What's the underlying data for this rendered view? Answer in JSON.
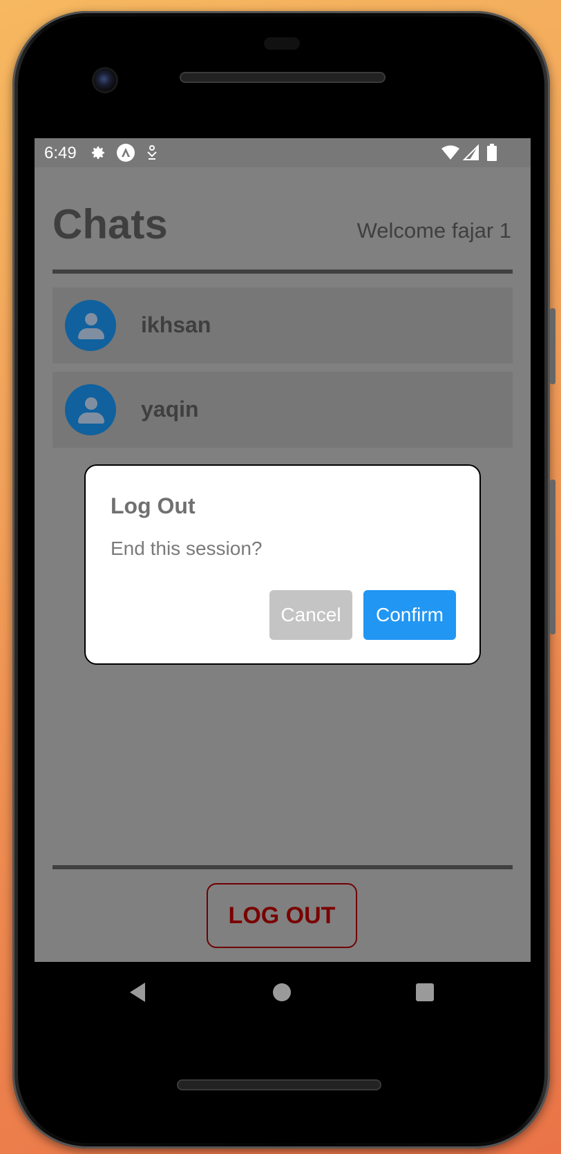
{
  "status_bar": {
    "time": "6:49",
    "icons_left": [
      "gear-icon",
      "app-logo-icon",
      "usb-debug-icon"
    ],
    "icons_right": [
      "wifi-icon",
      "signal-icon",
      "battery-icon"
    ]
  },
  "header": {
    "title": "Chats",
    "welcome": "Welcome fajar 1"
  },
  "chats": [
    {
      "name": "ikhsan",
      "avatar_icon": "person-icon"
    },
    {
      "name": "yaqin",
      "avatar_icon": "person-icon"
    }
  ],
  "footer": {
    "logout_label": "LOG OUT"
  },
  "dialog": {
    "title": "Log Out",
    "message": "End this session?",
    "cancel_label": "Cancel",
    "confirm_label": "Confirm"
  },
  "navbar": {
    "icons": [
      "back-icon",
      "home-icon",
      "recents-icon"
    ]
  },
  "colors": {
    "overlay_background": "#808080",
    "avatar": "#10619e",
    "confirm_button": "#2196f3",
    "cancel_button": "#c4c4c4",
    "logout_text": "#7a0000"
  }
}
